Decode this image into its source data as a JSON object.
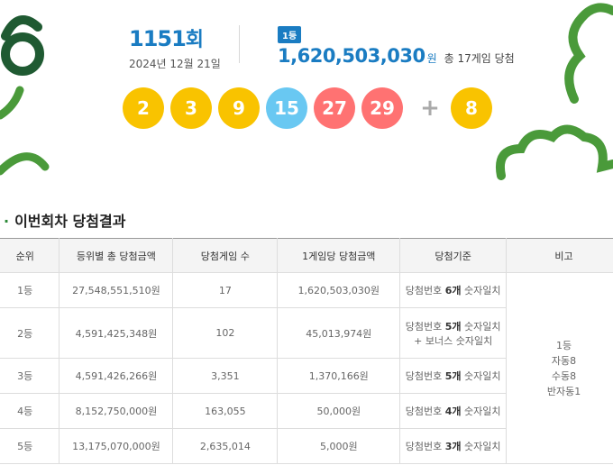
{
  "draw": {
    "round_number": "1151",
    "round_suffix": "회",
    "date": "2024년 12월 21일"
  },
  "first_prize": {
    "rank_badge": "1등",
    "amount": "1,620,503,030",
    "unit": "원",
    "winners_text": "총 17게임 당첨"
  },
  "balls": [
    {
      "value": "2",
      "color": "#f9c300"
    },
    {
      "value": "3",
      "color": "#f9c300"
    },
    {
      "value": "9",
      "color": "#f9c300"
    },
    {
      "value": "15",
      "color": "#69c8f2"
    },
    {
      "value": "27",
      "color": "#ff7272"
    },
    {
      "value": "29",
      "color": "#ff7272"
    }
  ],
  "plus_sign": "+",
  "bonus_ball": {
    "value": "8",
    "color": "#f9c300"
  },
  "section": {
    "bullet": "·",
    "title": "이번회차 당첨결과"
  },
  "table": {
    "headers": [
      "순위",
      "등위별 총 당첨금액",
      "당첨게임 수",
      "1게임당 당첨금액",
      "당첨기준",
      "비고"
    ],
    "rows": [
      {
        "rank": "1등",
        "total": "27,548,551,510원",
        "games": "17",
        "per_game": "1,620,503,030원",
        "crit_pre": "당첨번호 ",
        "crit_num": "6개",
        "crit_post": " 숫자일치",
        "crit_extra": ""
      },
      {
        "rank": "2등",
        "total": "4,591,425,348원",
        "games": "102",
        "per_game": "45,013,974원",
        "crit_pre": "당첨번호 ",
        "crit_num": "5개",
        "crit_post": " 숫자일치",
        "crit_extra": "+ 보너스 숫자일치"
      },
      {
        "rank": "3등",
        "total": "4,591,426,266원",
        "games": "3,351",
        "per_game": "1,370,166원",
        "crit_pre": "당첨번호 ",
        "crit_num": "5개",
        "crit_post": " 숫자일치",
        "crit_extra": ""
      },
      {
        "rank": "4등",
        "total": "8,152,750,000원",
        "games": "163,055",
        "per_game": "50,000원",
        "crit_pre": "당첨번호 ",
        "crit_num": "4개",
        "crit_post": " 숫자일치",
        "crit_extra": ""
      },
      {
        "rank": "5등",
        "total": "13,175,070,000원",
        "games": "2,635,014",
        "per_game": "5,000원",
        "crit_pre": "당첨번호 ",
        "crit_num": "3개",
        "crit_post": " 숫자일치",
        "crit_extra": ""
      }
    ],
    "note": {
      "line1": "1등",
      "line2": "자동8",
      "line3": "수동8",
      "line4": "반자동1"
    }
  },
  "colors": {
    "accent": "#1a7cc2",
    "deco_green": "#4a9a3a",
    "deco_dark": "#1f5a32"
  }
}
